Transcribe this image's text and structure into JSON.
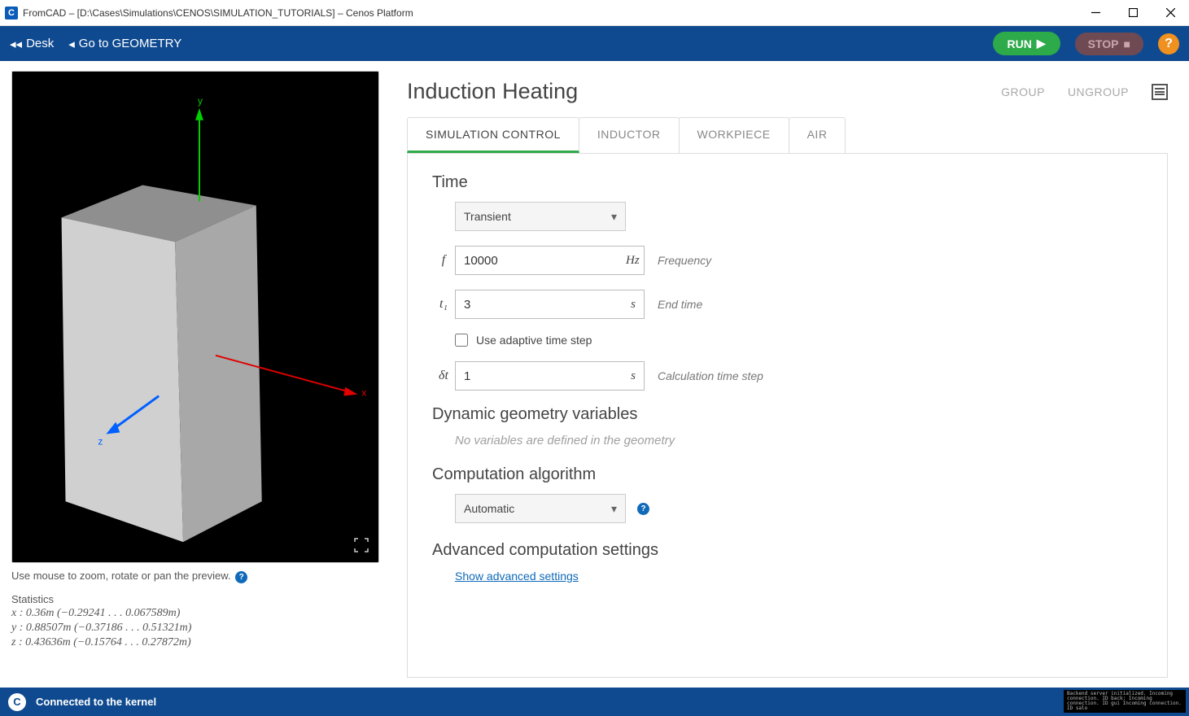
{
  "window": {
    "title": "FromCAD – [D:\\Cases\\Simulations\\CENOS\\SIMULATION_TUTORIALS] – Cenos Platform",
    "appicon_letter": "C"
  },
  "toolbar": {
    "desk": "Desk",
    "gotogeom": "Go to GEOMETRY",
    "run": "RUN",
    "stop": "STOP",
    "help": "?"
  },
  "viewport": {
    "axes": {
      "x": "x",
      "y": "y",
      "z": "z"
    },
    "hint": "Use mouse to zoom, rotate or pan the preview.",
    "stats_header": "Statistics",
    "stats": {
      "x": "x : 0.36m (−0.29241 . . . 0.067589m)",
      "y": "y : 0.88507m (−0.37186 . . . 0.51321m)",
      "z": "z : 0.43636m (−0.15764 . . . 0.27872m)"
    }
  },
  "page": {
    "title": "Induction Heating",
    "group": "GROUP",
    "ungroup": "UNGROUP"
  },
  "tabs": {
    "simctrl": "SIMULATION CONTROL",
    "inductor": "INDUCTOR",
    "workpiece": "WORKPIECE",
    "air": "AIR"
  },
  "sections": {
    "time": "Time",
    "dyn": "Dynamic geometry variables",
    "dyn_note": "No variables are defined in the geometry",
    "algo": "Computation algorithm",
    "adv": "Advanced computation settings",
    "adv_link": "Show advanced settings"
  },
  "time": {
    "mode_selected": "Transient",
    "f_sym": "f",
    "f_val": "10000",
    "f_unit": "Hz",
    "f_label": "Frequency",
    "t1_sym": "t₁",
    "t1_val": "3",
    "t1_unit": "s",
    "t1_label": "End time",
    "adaptive_label": "Use adaptive time step",
    "dt_sym": "δt",
    "dt_val": "1",
    "dt_unit": "s",
    "dt_label": "Calculation time step"
  },
  "algo": {
    "selected": "Automatic"
  },
  "status": {
    "text": "Connected to the kernel",
    "log": "Backend server initialized.\nIncoming connection. ID back:\nIncoming connection. ID gui\nIncoming connection. ID salo"
  }
}
